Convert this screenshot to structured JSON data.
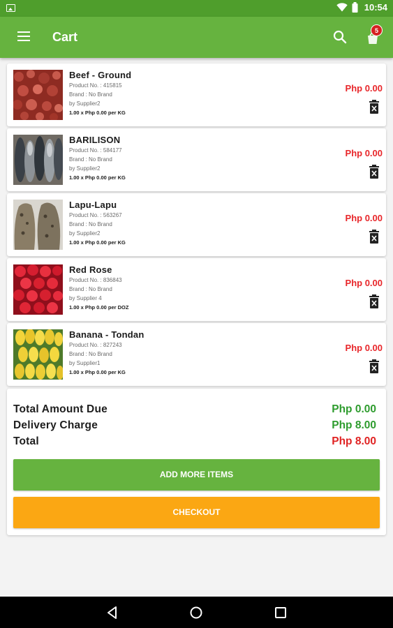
{
  "status_bar": {
    "time": "10:54"
  },
  "app_bar": {
    "title": "Cart",
    "cart_badge": "5"
  },
  "colors": {
    "primary": "#66b33f",
    "status_bar": "#4f9e2c",
    "price_red": "#e8262a",
    "amount_green": "#2e9c2e",
    "checkout_orange": "#fba713"
  },
  "items": [
    {
      "name": "Beef - Ground",
      "product_no": "Product No. : 415815",
      "brand": "Brand : No Brand",
      "supplier": "by Supplier2",
      "qty_line": "1.00 x Php 0.00 per KG",
      "price": "Php 0.00",
      "image": "ground-beef"
    },
    {
      "name": "BARILISON",
      "product_no": "Product No. : 584177",
      "brand": "Brand : No Brand",
      "supplier": "by Supplier2",
      "qty_line": "1.00 x Php 0.00 per KG",
      "price": "Php 0.00",
      "image": "fish-barilison"
    },
    {
      "name": "Lapu-Lapu",
      "product_no": "Product No. : 563267",
      "brand": "Brand : No Brand",
      "supplier": "by Supplier2",
      "qty_line": "1.00 x Php 0.00 per KG",
      "price": "Php 0.00",
      "image": "fish-lapu-lapu"
    },
    {
      "name": "Red Rose",
      "product_no": "Product No. : 836843",
      "brand": "Brand : No Brand",
      "supplier": "by Supplier 4",
      "qty_line": "1.00 x Php 0.00 per DOZ",
      "price": "Php 0.00",
      "image": "red-roses"
    },
    {
      "name": "Banana - Tondan",
      "product_no": "Product No. : 827243",
      "brand": "Brand : No Brand",
      "supplier": "by Supplier1",
      "qty_line": "1.00 x Php 0.00 per KG",
      "price": "Php 0.00",
      "image": "bananas"
    }
  ],
  "summary": {
    "total_amount_due_label": "Total Amount Due",
    "total_amount_due": "Php 0.00",
    "delivery_charge_label": "Delivery Charge",
    "delivery_charge": "Php 8.00",
    "total_label": "Total",
    "total": "Php 8.00"
  },
  "buttons": {
    "add_more": "ADD MORE ITEMS",
    "checkout": "CHECKOUT"
  },
  "icons": [
    "image-icon",
    "wifi-icon",
    "battery-icon",
    "menu-icon",
    "search-icon",
    "cart-icon",
    "delete-icon",
    "back-icon",
    "home-icon",
    "recents-icon"
  ]
}
